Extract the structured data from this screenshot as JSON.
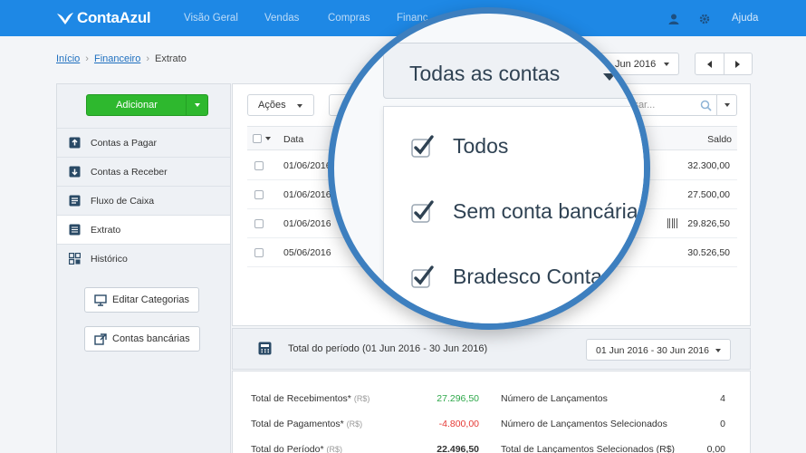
{
  "brand": {
    "name": "ContaAzul",
    "top_color": "#1e88e5",
    "ring_color": "#3d7fbf"
  },
  "nav": {
    "items": [
      "Visão Geral",
      "Vendas",
      "Compras",
      "Financ"
    ],
    "help": "Ajuda"
  },
  "breadcrumb": {
    "home": "Início",
    "finance": "Financeiro",
    "current": "Extrato"
  },
  "date_filter": {
    "value": "Jun 2016"
  },
  "sidebar": {
    "add_label": "Adicionar",
    "items": [
      "Contas a Pagar",
      "Contas a Receber",
      "Fluxo de Caixa",
      "Extrato",
      "Histórico"
    ],
    "active": "Extrato",
    "edit_categories": "Editar Categorias",
    "bank_accounts": "Contas bancárias"
  },
  "toolbar": {
    "actions": "Ações",
    "search_placeholder": "isar..."
  },
  "table": {
    "headers": {
      "date": "Data",
      "balance": "Saldo"
    },
    "rows": [
      {
        "date": "01/06/2016",
        "balance": "32.300,00"
      },
      {
        "date": "01/06/2016",
        "balance": "27.500,00"
      },
      {
        "date": "01/06/2016",
        "balance": "29.826,50"
      },
      {
        "date": "05/06/2016",
        "balance": "30.526,50"
      }
    ]
  },
  "period": {
    "label": "Total do período (01 Jun 2016 - 30 Jun 2016)",
    "selector": "01 Jun 2016 - 30 Jun 2016"
  },
  "totals": {
    "receipts": {
      "label": "Total de Recebimentos*",
      "unit": "(R$)",
      "value": "27.296,50"
    },
    "payments": {
      "label": "Total de Pagamentos*",
      "unit": "(R$)",
      "value": "-4.800,00"
    },
    "period": {
      "label": "Total do Período*",
      "unit": "(R$)",
      "value": "22.496,50"
    },
    "entries_count": {
      "label": "Número de Lançamentos",
      "value": "4"
    },
    "selected_count": {
      "label": "Número de Lançamentos Selecionados",
      "value": "0"
    },
    "selected_total": {
      "label": "Total de Lançamentos Selecionados",
      "unit": "(R$)",
      "value": "0,00"
    }
  },
  "magnifier": {
    "title": "Todas as contas",
    "options": [
      "Todos",
      "Sem conta bancária",
      "Bradesco Conta"
    ]
  }
}
